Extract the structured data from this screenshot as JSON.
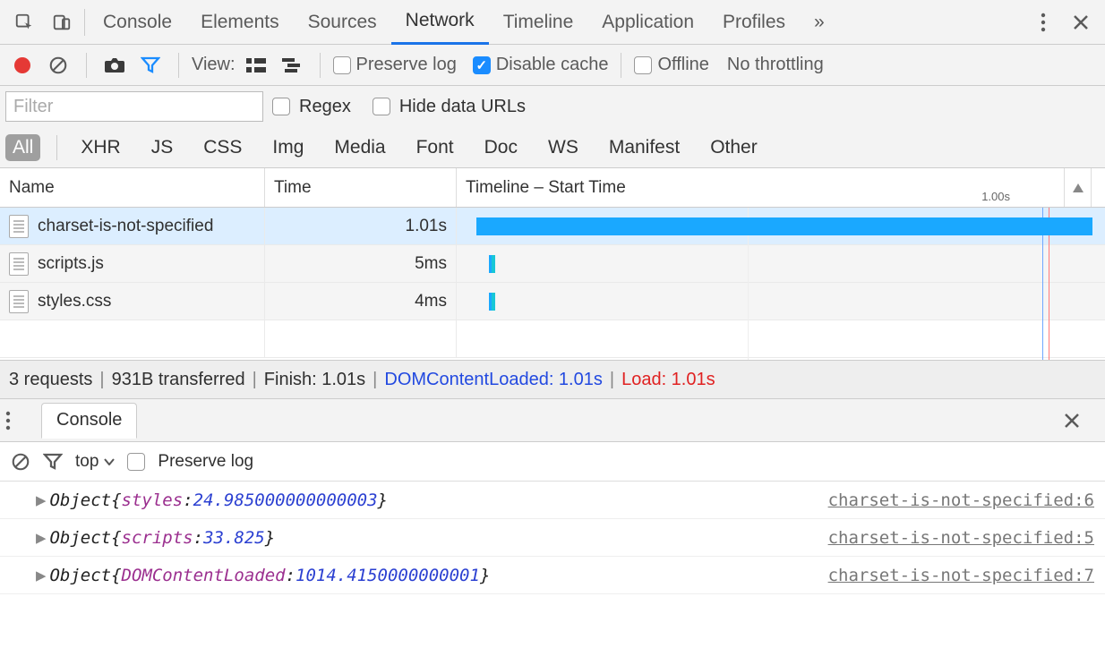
{
  "tabs": {
    "items": [
      "Console",
      "Elements",
      "Sources",
      "Network",
      "Timeline",
      "Application",
      "Profiles"
    ],
    "active": "Network"
  },
  "toolbar": {
    "view_label": "View:",
    "preserve_log": "Preserve log",
    "preserve_log_checked": false,
    "disable_cache": "Disable cache",
    "disable_cache_checked": true,
    "offline": "Offline",
    "offline_checked": false,
    "throttling": "No throttling"
  },
  "filter": {
    "placeholder": "Filter",
    "regex_label": "Regex",
    "regex_checked": false,
    "hide_data_urls_label": "Hide data URLs",
    "hide_data_urls_checked": false
  },
  "types": [
    "All",
    "XHR",
    "JS",
    "CSS",
    "Img",
    "Media",
    "Font",
    "Doc",
    "WS",
    "Manifest",
    "Other"
  ],
  "types_active": "All",
  "table": {
    "headers": {
      "name": "Name",
      "time": "Time",
      "timeline": "Timeline – Start Time"
    },
    "timeline_scale": "1.00s",
    "rows": [
      {
        "name": "charset-is-not-specified",
        "time": "1.01s",
        "bar_left_pct": 3,
        "bar_width_pct": 95,
        "selected": true
      },
      {
        "name": "scripts.js",
        "time": "5ms",
        "bar_left_pct": 5,
        "bar_width_pct": 1
      },
      {
        "name": "styles.css",
        "time": "4ms",
        "bar_left_pct": 5,
        "bar_width_pct": 1
      }
    ],
    "grid_pct": 48,
    "blue_line_pct": 96.5,
    "red_line_pct": 97.5
  },
  "summary": {
    "requests": "3 requests",
    "transferred": "931B transferred",
    "finish": "Finish: 1.01s",
    "dcl": "DOMContentLoaded: 1.01s",
    "load": "Load: 1.01s"
  },
  "drawer": {
    "tab": "Console",
    "scope": "top",
    "preserve_log": "Preserve log",
    "preserve_log_checked": false,
    "rows": [
      {
        "key": "styles",
        "value": "24.985000000000003",
        "source": "charset-is-not-specified:6"
      },
      {
        "key": "scripts",
        "value": "33.825",
        "source": "charset-is-not-specified:5"
      },
      {
        "key": "DOMContentLoaded",
        "value": "1014.4150000000001",
        "source": "charset-is-not-specified:7"
      }
    ]
  }
}
